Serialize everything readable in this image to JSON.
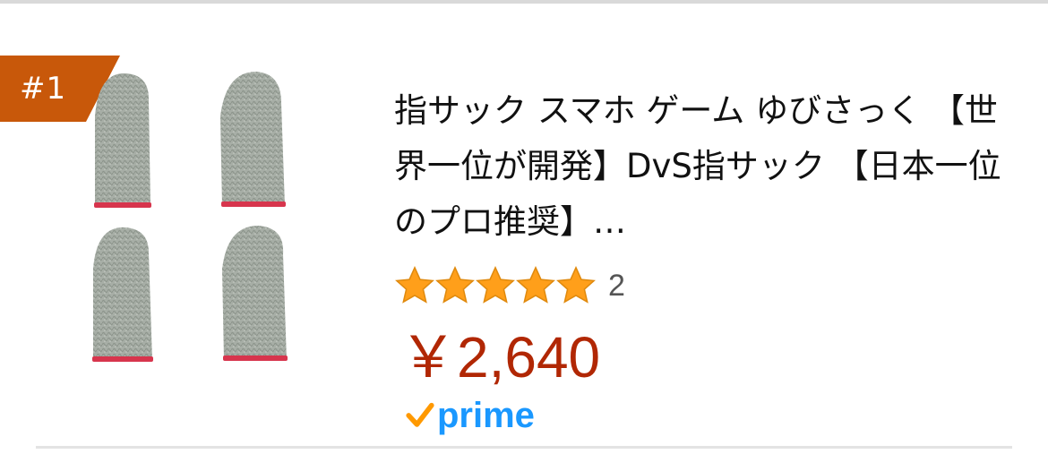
{
  "product": {
    "rank": "#1",
    "title": "指サック スマホ ゲーム ゆびさっく 【世界一位が開発】DvS指サック 【日本一位のプロ推奨】…",
    "image": "finger-sleeves-product-image",
    "rating": {
      "stars": 5,
      "max_stars": 5,
      "review_count": "2"
    },
    "price": "￥2,640",
    "prime_label": "prime"
  },
  "colors": {
    "rank_badge": "#c8580a",
    "price": "#b12704",
    "star": "#ff9f1a",
    "prime": "#1a98ff",
    "prime_check": "#ff9900"
  },
  "icons": {
    "star": "star-icon",
    "prime_check": "check-icon"
  }
}
